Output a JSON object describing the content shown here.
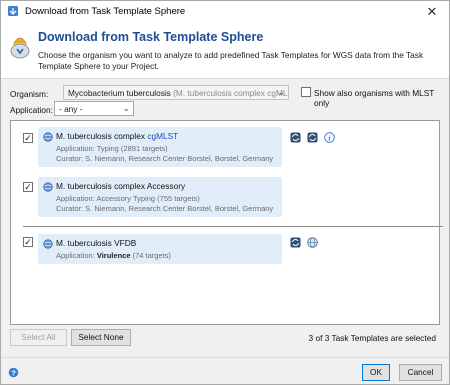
{
  "window": {
    "title": "Download from Task Template Sphere",
    "close_glyph": "✕"
  },
  "header": {
    "title": "Download from Task Template Sphere",
    "description": "Choose the organism you want to analyze to add predefined Task Templates for WGS data from the Task Template Sphere to your Project."
  },
  "organism": {
    "label": "Organism:",
    "value": "Mycobacterium tuberculosis",
    "value_detail": "(M. tuberculosis complex cgMLST)",
    "show_mlst_label": "Show also organisms with MLST only",
    "show_mlst_checked": false
  },
  "application": {
    "label": "Application:",
    "value": "- any -"
  },
  "templates": [
    {
      "checked": true,
      "name_prefix": "M. tuberculosis complex ",
      "name_highlight": "cgMLST",
      "application_label": "Application: ",
      "application_value": "Typing",
      "application_detail": " (2891 targets)",
      "application_bold": false,
      "curator": "Curator: S. Niemann, Research Center Borstel, Borstel, Germany",
      "icon": "template-icon",
      "actions": [
        "sync-icon",
        "sync-icon",
        "info-icon"
      ]
    },
    {
      "checked": true,
      "name_prefix": "M. tuberculosis complex Accessory",
      "name_highlight": "",
      "application_label": "Application: ",
      "application_value": "Accessory Typing",
      "application_detail": " (755 targets)",
      "application_bold": false,
      "curator": "Curator: S. Niemann, Research Center Borstel, Borstel, Germany",
      "icon": "template-icon",
      "actions": []
    },
    {
      "checked": true,
      "name_prefix": "M. tuberculosis VFDB",
      "name_highlight": "",
      "application_label": "Application: ",
      "application_value": "Virulence",
      "application_detail": " (74 targets)",
      "application_bold": true,
      "curator": "",
      "icon": "template-icon",
      "actions": [
        "sync-icon",
        "globe-icon"
      ]
    }
  ],
  "buttons": {
    "select_all": "Select All",
    "select_none": "Select None",
    "ok": "OK",
    "cancel": "Cancel"
  },
  "status": "3 of 3 Task Templates are selected",
  "colors": {
    "title_blue": "#1f4e91",
    "card_bg": "#e1eefa",
    "highlight_blue": "#1f4fb8"
  }
}
